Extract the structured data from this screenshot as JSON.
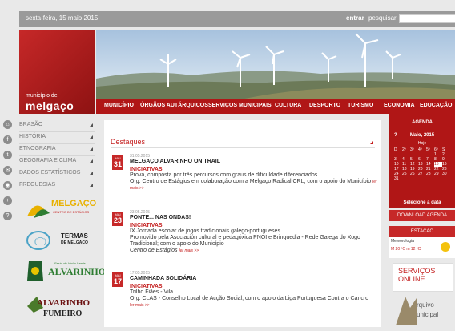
{
  "topbar": {
    "date": "sexta-feira, 15 maio 2015",
    "login": "entrar",
    "search_label": "pesquisar",
    "go": "›"
  },
  "logo": {
    "line1": "município de",
    "line2": "melgaço"
  },
  "nav": [
    "MUNICÍPIO",
    "ÓRGÃOS AUTÁRQUICOS",
    "SERVIÇOS MUNICIPAIS",
    "CULTURA",
    "DESPORTO",
    "TURISMO",
    "ECONOMIA",
    "EDUCAÇÃO"
  ],
  "menu": [
    "BRASÃO",
    "HISTÓRIA",
    "ETNOGRAFIA",
    "GEOGRAFIA E CLIMA",
    "DADOS ESTATÍSTICOS",
    "FREGUESIAS"
  ],
  "partners": [
    {
      "name": "MELGAÇO",
      "sub": "CENTRO DE ESTÁGIOS"
    },
    {
      "name": "TERMAS",
      "sub": "DE MELGAÇO"
    },
    {
      "name": "ALVARINHO",
      "sub": "Festa do Vinho Verde"
    },
    {
      "name": "ALVARINHO",
      "sub": "FUMEIRO"
    }
  ],
  "main": {
    "heading": "Destaques",
    "news": [
      {
        "month": "MAI",
        "day": "31",
        "timestamp": "31.05.2015",
        "title": "MELGAÇO ALVARINHO ON TRAIL",
        "category": "INICIATIVAS",
        "text": [
          "Prova, composta por três percursos com graus de dificuldade diferenciados",
          "Org. Centro de Estágios em colaboração com a Melgaço Radical CRL, com o apoio do Município"
        ],
        "more": "ler mais >>"
      },
      {
        "month": "MAI",
        "day": "23",
        "timestamp": "23.05.2015",
        "title": "PONTE... NAS ONDAS!",
        "category": "INICIATIVAS",
        "text": [
          "IX Jornada escolar de jogos tradicionais galego-portugueses",
          "Promovido pela Asociación cultural e pedagóxica PNOI e Brinquedia - Rede Galega do Xogo Tradicional; com o apoio do Município",
          "Centro de Estágios"
        ],
        "more": "ler mais >>"
      },
      {
        "month": "MAI",
        "day": "17",
        "timestamp": "17.05.2015",
        "title": "CAMINHADA SOLIDÁRIA",
        "category": "INICIATIVAS",
        "text": [
          "Trilho Fiães - Vila",
          "Org. CLAS - Conselho Local de Acção Social, com o apoio da Liga Portuguesa Contra o Cancro"
        ],
        "more": "ler mais >>"
      }
    ]
  },
  "agenda": {
    "title": "AGENDA",
    "month_year": "Maio, 2015",
    "prev": "?",
    "today": "Hoje",
    "weekdays": [
      "D",
      "2ª",
      "3ª",
      "4ª",
      "5ª",
      "6ª",
      "S"
    ],
    "weeks": [
      [
        "",
        "",
        "",
        "",
        "",
        "1",
        "2"
      ],
      [
        "3",
        "4",
        "5",
        "6",
        "7",
        "8",
        "9"
      ],
      [
        "10",
        "11",
        "12",
        "13",
        "14",
        "15",
        "16"
      ],
      [
        "17",
        "18",
        "19",
        "20",
        "21",
        "22",
        "23"
      ],
      [
        "24",
        "25",
        "26",
        "27",
        "28",
        "29",
        "30"
      ],
      [
        "31",
        "",
        "",
        "",
        "",
        "",
        ""
      ]
    ],
    "select_date": "Selecione a data"
  },
  "download_agenda": "DOWNLOAD AGENDA",
  "estacao": "ESTAÇÃO",
  "meteo": {
    "label": "Meteorologia",
    "temps": "M 20 ºC m 12 ºC"
  },
  "servicos": {
    "line1": "SERVIÇOS",
    "line2": "ONLINE"
  },
  "arquivo": {
    "line1": "rquivo",
    "line2": "unicipal"
  },
  "colors": {
    "brand_red": "#b01616"
  }
}
